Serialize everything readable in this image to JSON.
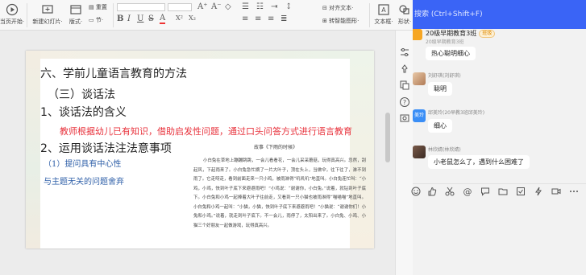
{
  "ribbon": {
    "play_label": "当页开始·",
    "new_slide_label": "新建幻灯片·",
    "layout_label": "版式·",
    "section_label": "节·",
    "reset_label": "重置",
    "bold": "B",
    "italic": "I",
    "underline": "U",
    "strike": "S",
    "font_color": "A",
    "superscript": "X²",
    "subscript": "X₂",
    "clear": "◇",
    "grow_font": "A⁺",
    "shrink_font": "A⁻",
    "align_text_label": "对齐文本·",
    "convert_shape_label": "转智能图形·",
    "textbox_label": "文本框·",
    "shape_label": "形状·"
  },
  "slide": {
    "line1": "六、学前儿童语言教育的方法",
    "line2": "（三）谈话法",
    "line3": "1、谈话法的含义",
    "line4": "教师根据幼儿已有知识，借助启发性问题，通过口头问答方式进行语言教育",
    "line5": "2、运用谈话法注法意事项",
    "line6": "（1）提问具有中心性",
    "line7": "与主题无关的问题舍弃",
    "story_title": "故事《下雨的时候》",
    "story_text": "小白兔在草地上蹦蹦跳跳，一会儿看看花，一会儿采采蘑菇，玩得真高兴。忽然，刮起风，下起雨来了。小白兔急忙摘了一片大叶子，顶在头上，当做伞，往下往了，淋不到雨了。它走呀走，看到前面走来一只小鸡，被雨淋得“叽叽叽”地直叫。小白兔连忙叫：“小鸡，小鸡，快到叶子底下来避避雨吧！”小鸡说：“谢谢你，小白兔。”说着，就钻到叶子底下。小白兔和小鸡一起捧着大叶子往前走，又看到一只小猫也被雨淋得“喵喵喵”地直叫。小白兔和小鸡一起叫：“小猫，小猫，快到叶子底下来避避雨吧！”小猫说：“谢谢你们！小兔和小鸡。”说着，就走到叶子底下。不一会儿，雨停了，太阳出来了。小白兔、小鸡、小猫三个好朋友一起做游戏，玩得真高兴。"
  },
  "chat": {
    "search_placeholder": "搜索 (Ctrl+Shift+F)",
    "group_name": "20级早期教育3班",
    "group_tag": "班级",
    "group_sub": "20级早期教育3班",
    "messages": [
      {
        "sender": "",
        "text": "热心聪明细心"
      },
      {
        "sender": "刘舒琪(刘舒琪)",
        "text": "聪明"
      },
      {
        "sender": "邱美玲(20早教3班邱美玲)",
        "text": "细心"
      },
      {
        "sender": "林欣婧(林欣婧)",
        "text": "小老鼠怎么了，遇到什么困难了"
      }
    ],
    "avatar_text_3": "美玲"
  },
  "colors": {
    "accent": "#3a64f6",
    "red_text": "#e8323c",
    "blue_text": "#2e5fa8"
  }
}
